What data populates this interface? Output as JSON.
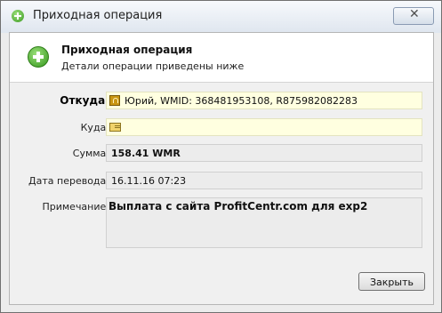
{
  "window": {
    "title": "Приходная операция"
  },
  "header": {
    "title": "Приходная операция",
    "subtitle": "Детали операции приведены ниже"
  },
  "form": {
    "from_label": "Откуда:",
    "from_value": "Юрий, WMID: 368481953108, R875982082283",
    "to_label": "Куда:",
    "to_value": "",
    "amount_label": "Сумма:",
    "amount_value": "158.41 WMR",
    "date_label": "Дата перевода:",
    "date_value": "16.11.16 07:23",
    "note_label": "Примечание:",
    "note_value": "Выплата с сайта ProfitCentr.com для exp2"
  },
  "footer": {
    "close_label": "Закрыть"
  }
}
